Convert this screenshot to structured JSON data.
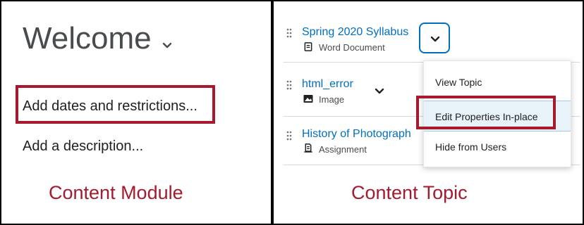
{
  "left_panel": {
    "module_title": "Welcome",
    "restrictions_link": "Add dates and restrictions...",
    "description_link": "Add a description...",
    "caption": "Content Module"
  },
  "right_panel": {
    "topics": [
      {
        "title": "Spring 2020 Syllabus",
        "type": "Word Document",
        "icon": "document-icon"
      },
      {
        "title": "html_error",
        "type": "Image",
        "icon": "image-icon"
      },
      {
        "title": "History of Photograph",
        "type": "Assignment",
        "icon": "assignment-icon"
      }
    ],
    "context_menu": {
      "items": [
        "View Topic",
        "Edit Properties In-place",
        "Hide from Users"
      ],
      "selected": "Edit Properties In-place"
    },
    "caption": "Content Topic"
  },
  "colors": {
    "highlight": "#a6192e",
    "link": "#006fbf",
    "caption": "#a6192e"
  }
}
